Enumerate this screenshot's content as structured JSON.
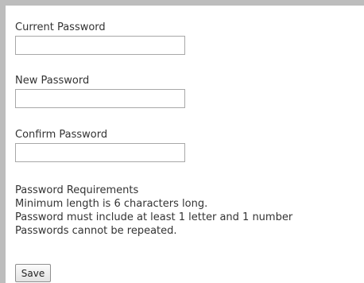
{
  "form": {
    "current_password": {
      "label": "Current Password",
      "value": ""
    },
    "new_password": {
      "label": "New Password",
      "value": ""
    },
    "confirm_password": {
      "label": "Confirm Password",
      "value": ""
    },
    "requirements": {
      "title": "Password Requirements",
      "lines": [
        "Minimum length is 6 characters long.",
        "Password must include at least 1 letter and 1 number",
        "Passwords cannot be repeated."
      ]
    },
    "save_label": "Save"
  }
}
